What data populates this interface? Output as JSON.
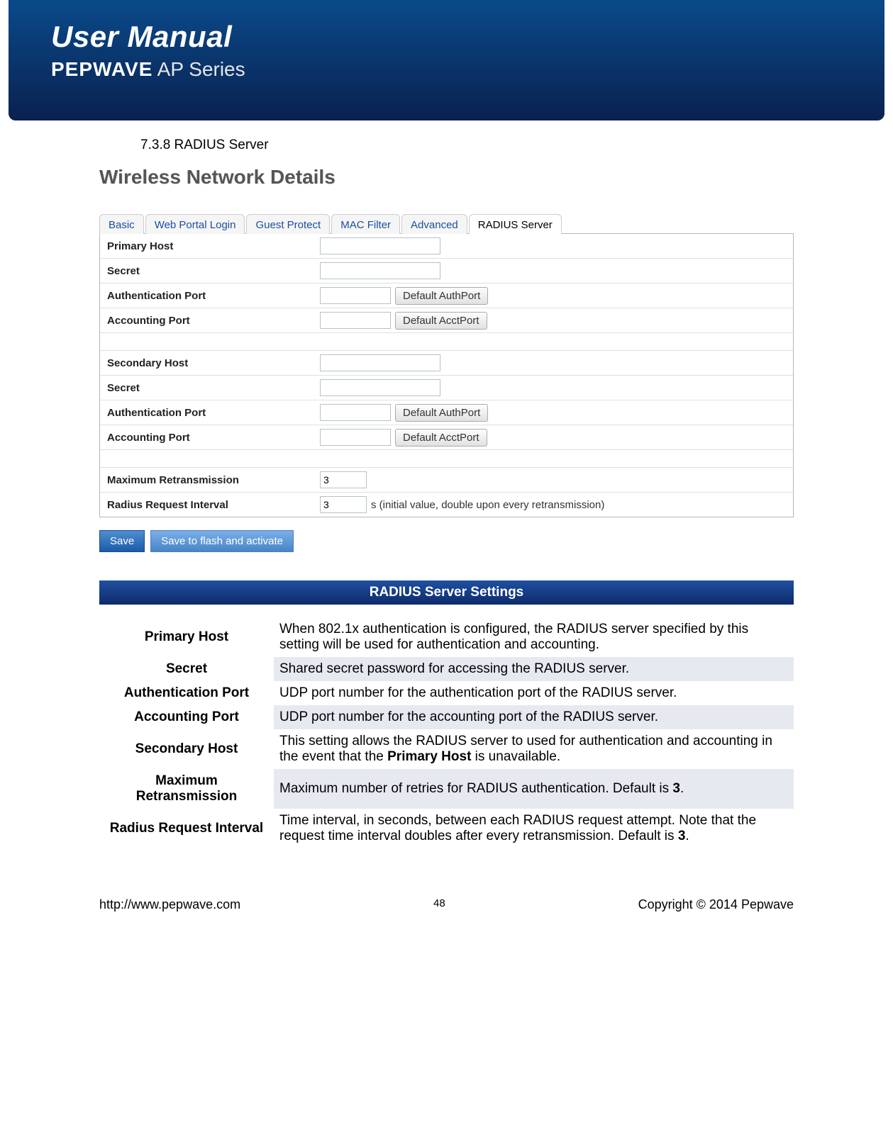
{
  "banner": {
    "title": "User Manual",
    "brand": "PEPWAVE",
    "series": "AP Series"
  },
  "section": {
    "number": "7.3.8",
    "title": "RADIUS Server"
  },
  "wnd_title": "Wireless Network Details",
  "tabs": {
    "items": [
      "Basic",
      "Web Portal Login",
      "Guest Protect",
      "MAC Filter",
      "Advanced",
      "RADIUS Server"
    ],
    "active_index": 5
  },
  "form": {
    "primary_host": {
      "label": "Primary Host",
      "value": ""
    },
    "secret1": {
      "label": "Secret",
      "value": ""
    },
    "auth_port1": {
      "label": "Authentication Port",
      "value": "",
      "button": "Default AuthPort"
    },
    "acct_port1": {
      "label": "Accounting Port",
      "value": "",
      "button": "Default AcctPort"
    },
    "secondary_host": {
      "label": "Secondary Host",
      "value": ""
    },
    "secret2": {
      "label": "Secret",
      "value": ""
    },
    "auth_port2": {
      "label": "Authentication Port",
      "value": "",
      "button": "Default AuthPort"
    },
    "acct_port2": {
      "label": "Accounting Port",
      "value": "",
      "button": "Default AcctPort"
    },
    "max_retrans": {
      "label": "Maximum Retransmission",
      "value": "3"
    },
    "req_interval": {
      "label": "Radius Request Interval",
      "value": "3",
      "note": "s (initial value, double upon every retransmission)"
    }
  },
  "save_buttons": {
    "save": "Save",
    "save_flash": "Save to flash and activate"
  },
  "settings": {
    "title": "RADIUS Server Settings",
    "rows": [
      {
        "key": "Primary Host",
        "desc": "When 802.1x authentication is configured, the RADIUS server specified by this setting will be used for authentication and accounting."
      },
      {
        "key": "Secret",
        "desc": "Shared secret password for accessing the RADIUS server."
      },
      {
        "key": "Authentication Port",
        "desc": "UDP port number for the authentication port of the RADIUS server."
      },
      {
        "key": "Accounting Port",
        "desc": "UDP port number for the accounting port of the RADIUS server."
      },
      {
        "key": "Secondary Host",
        "desc_pre": "This setting allows the RADIUS server to used for authentication and accounting in the event that the ",
        "desc_bold": "Primary Host",
        "desc_post": " is unavailable."
      },
      {
        "key": "Maximum Retransmission",
        "desc_pre": "Maximum number of retries for RADIUS authentication. Default is ",
        "desc_bold": "3",
        "desc_post": "."
      },
      {
        "key": "Radius Request Interval",
        "desc_pre": "Time interval, in seconds, between each RADIUS request attempt.   Note that the request time interval doubles after every retransmission. Default is ",
        "desc_bold": "3",
        "desc_post": "."
      }
    ]
  },
  "footer": {
    "url": "http://www.pepwave.com",
    "page": "48",
    "copyright": "Copyright © 2014 Pepwave"
  }
}
